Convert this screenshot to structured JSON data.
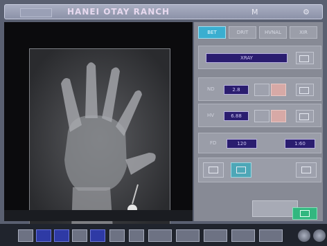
{
  "header": {
    "title": "HANEI OTAY RANCH",
    "left_label": "",
    "mid_icon": "M",
    "right_icon": "settings-icon"
  },
  "tabs": [
    {
      "label": "BET",
      "active": true
    },
    {
      "label": "DRIT",
      "active": false
    },
    {
      "label": "HVNAL",
      "active": false
    },
    {
      "label": "XIR",
      "active": false
    }
  ],
  "panel": {
    "mode_value": "XRAY",
    "param1": {
      "label": "ND",
      "value": "2.8"
    },
    "param2": {
      "label": "HV",
      "value": "6.88"
    },
    "range": {
      "label": "FD",
      "min": "120",
      "max": "1:60"
    }
  },
  "colors": {
    "accent": "#3aaed0",
    "value_box": "#2a1d6f",
    "confirm": "#32b77f"
  }
}
